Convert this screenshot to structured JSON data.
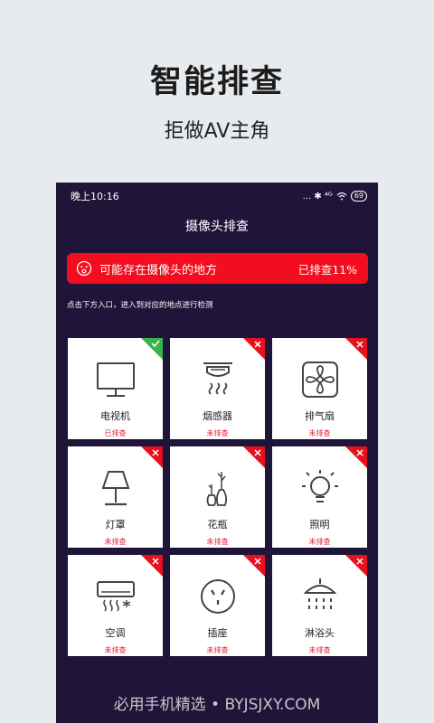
{
  "promo": {
    "title": "智能排查",
    "subtitle": "拒做AV主角"
  },
  "status_bar": {
    "time": "晚上10:16",
    "signal": "... ✱ ⁴ᴳ",
    "battery": "69"
  },
  "screen": {
    "title": "摄像头排查",
    "alert": {
      "text": "可能存在摄像头的地方",
      "progress": "已排查11%",
      "color": "#f20d1f"
    },
    "hint": "点击下方入口，进入到对应的地点进行检测"
  },
  "locations": [
    {
      "label": "电视机",
      "status": "已排查",
      "checked": true,
      "icon": "tv-icon"
    },
    {
      "label": "烟感器",
      "status": "未排查",
      "checked": false,
      "icon": "smoke-detector-icon"
    },
    {
      "label": "排气扇",
      "status": "未排查",
      "checked": false,
      "icon": "exhaust-fan-icon"
    },
    {
      "label": "灯罩",
      "status": "未排查",
      "checked": false,
      "icon": "lamp-icon"
    },
    {
      "label": "花瓶",
      "status": "未排查",
      "checked": false,
      "icon": "vase-icon"
    },
    {
      "label": "照明",
      "status": "未排查",
      "checked": false,
      "icon": "light-bulb-icon"
    },
    {
      "label": "空调",
      "status": "未排查",
      "checked": false,
      "icon": "air-conditioner-icon"
    },
    {
      "label": "插座",
      "status": "未排查",
      "checked": false,
      "icon": "socket-icon"
    },
    {
      "label": "淋浴头",
      "status": "未排查",
      "checked": false,
      "icon": "shower-head-icon"
    }
  ],
  "colors": {
    "checked": "#38b24a",
    "unchecked": "#e8101f",
    "background": "#1f1538"
  },
  "footer": "必用手机精选 • BYJSJXY.COM"
}
